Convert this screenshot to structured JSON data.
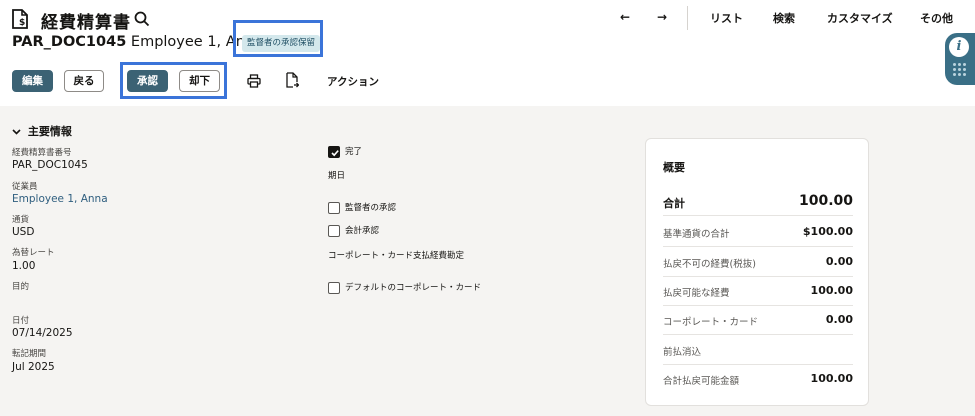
{
  "header": {
    "title": "経費精算書",
    "nav": {
      "prev": "←",
      "next": "→",
      "list": "リスト",
      "search": "検索",
      "customize": "カスタマイズ",
      "other": "その他"
    },
    "doc_number": "PAR_DOC1045",
    "employee": "Employee 1, Anna",
    "status": "監督者の承認保留"
  },
  "toolbar": {
    "edit": "編集",
    "back": "戻る",
    "approve": "承認",
    "reject": "却下",
    "action": "アクション"
  },
  "main_info": {
    "section_title": "主要情報",
    "fields": {
      "doc_no_label": "経費精算書番号",
      "doc_no_value": "PAR_DOC1045",
      "employee_label": "従業員",
      "employee_value": "Employee 1, Anna",
      "currency_label": "通貨",
      "currency_value": "USD",
      "rate_label": "為替レート",
      "rate_value": "1.00",
      "purpose_label": "目的",
      "date_label": "日付",
      "date_value": "07/14/2025",
      "period_label": "転記期間",
      "period_value": "Jul 2025"
    },
    "checks": {
      "complete": "完了",
      "due_date_label": "期日",
      "supervisor_approval": "監督者の承認",
      "accounting_approval": "会計承認",
      "corp_card_account_label": "コーポレート・カード支払経費勘定",
      "default_corp_card": "デフォルトのコーポレート・カード"
    }
  },
  "summary": {
    "title": "概要",
    "rows": [
      {
        "label": "合計",
        "value": "100.00"
      },
      {
        "label": "基準通貨の合計",
        "value": "$100.00"
      },
      {
        "label": "払戻不可の経費(税抜)",
        "value": "0.00"
      },
      {
        "label": "払戻可能な経費",
        "value": "100.00"
      },
      {
        "label": "コーポレート・カード",
        "value": "0.00"
      },
      {
        "label": "前払消込",
        "value": ""
      },
      {
        "label": "合計払戻可能金額",
        "value": "100.00"
      }
    ]
  },
  "colors": {
    "primary_button": "#3b6274",
    "highlight": "#3b74d9",
    "status_badge_bg": "#d4e8ec",
    "side_widget": "#3a6f86"
  }
}
